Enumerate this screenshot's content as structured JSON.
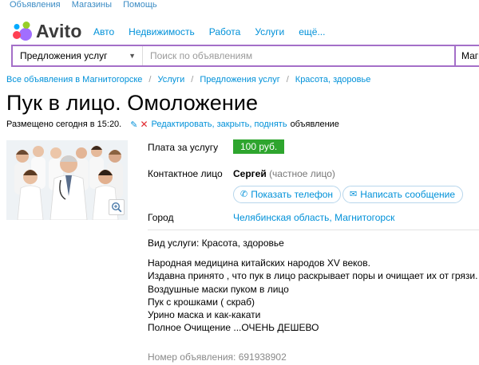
{
  "topbar": {
    "items": [
      "Объявления",
      "Магазины",
      "Помощь"
    ]
  },
  "logo": {
    "text": "Avito"
  },
  "nav": {
    "items": [
      "Авто",
      "Недвижимость",
      "Работа",
      "Услуги",
      "ещё..."
    ]
  },
  "search": {
    "category": "Предложения услуг",
    "placeholder": "Поиск по объявлениям",
    "city": "Магнит"
  },
  "breadcrumbs": [
    "Все объявления в Магнитогорске",
    "Услуги",
    "Предложения услуг",
    "Красота, здоровье"
  ],
  "ad": {
    "title": "Пук в лицо. Омоложение",
    "posted": "Размещено сегодня в 15:20.",
    "edit_link": "Редактировать, закрыть, поднять",
    "edit_suffix": "объявление",
    "price_label": "Плата за услугу",
    "price": "100 руб.",
    "contact_label": "Контактное лицо",
    "seller_name": "Сергей",
    "seller_type": "(частное лицо)",
    "show_phone": "Показать телефон",
    "write_message": "Написать сообщение",
    "city_label": "Город",
    "city": "Челябинская область, Магнитогорск",
    "service_type": "Вид услуги: Красота, здоровье",
    "description": [
      "Народная медицина китайских народов XV веков.",
      "Издавна принято , что пук в лицо раскрывает поры и очищает их от грязи.",
      "Воздушные маски пуком в лицо",
      "Пук с крошками ( скраб)",
      "Урино маска и как-какати",
      "Полное Очищение ...ОЧЕНЬ ДЕШЕВО"
    ],
    "ad_number": "Номер объявления: 691938902"
  },
  "colors": {
    "accent": "#0091d9",
    "search_border": "#a46fc8",
    "price_bg": "#2ea52e",
    "delete": "#e0262c"
  }
}
